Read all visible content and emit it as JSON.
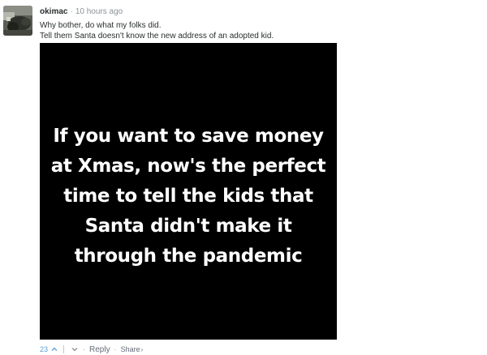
{
  "comment": {
    "author": "okimac",
    "timestamp": "10 hours ago",
    "separator": "·",
    "lines": [
      "Why bother, do what my folks did.",
      "Tell them Santa doesn't know the new address of an adopted kid."
    ]
  },
  "meme": {
    "lines": [
      "If you want to save money",
      "at Xmas, now's the perfect",
      "time to tell the kids that",
      "Santa didn't make it",
      "through the pandemic"
    ]
  },
  "footer": {
    "vote_count": "23",
    "reply_label": "Reply",
    "share_label": "Share",
    "share_arrow": "›",
    "dot": "·",
    "upvote_icon": "chevron-up-icon",
    "downvote_icon": "chevron-down-icon"
  },
  "colors": {
    "accent": "#5aa0d8",
    "meme_bg": "#000000",
    "meme_text": "#ffffff",
    "muted": "#656c7a"
  }
}
